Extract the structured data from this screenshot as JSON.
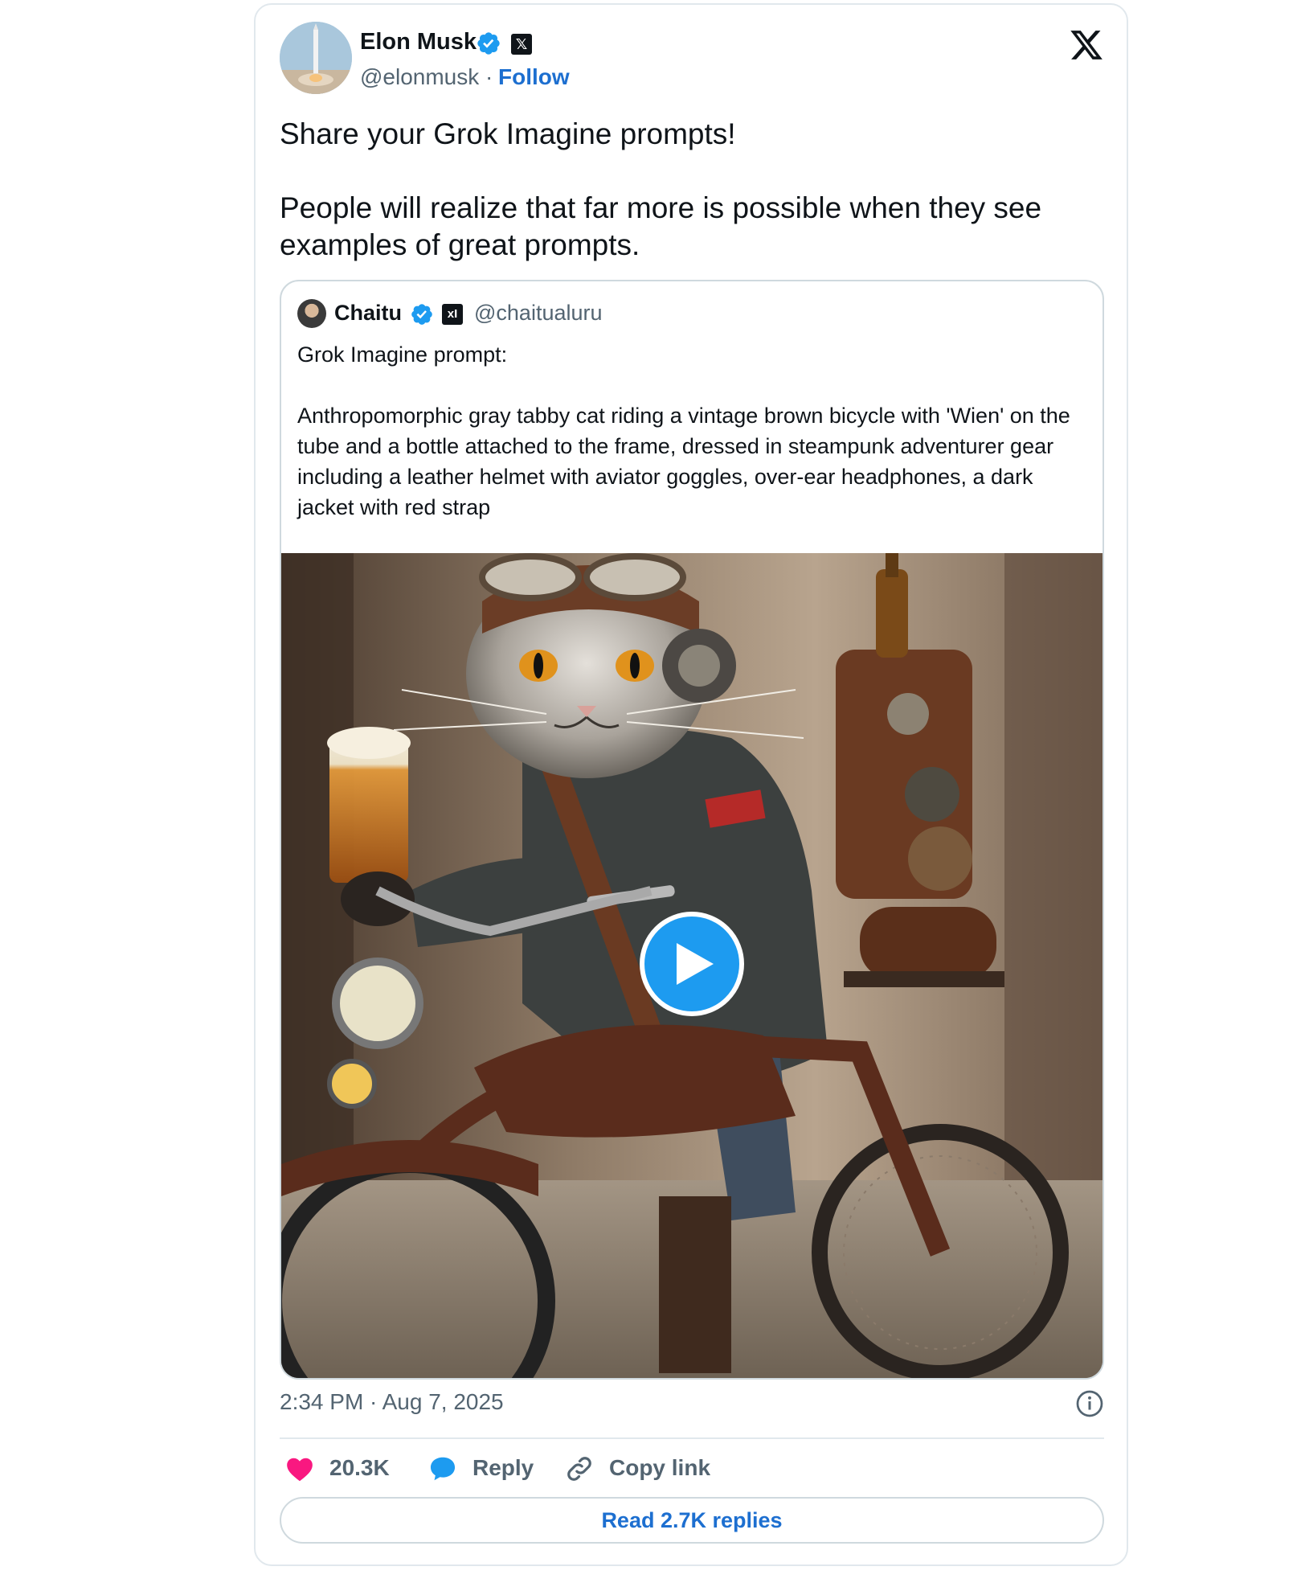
{
  "author": {
    "name": "Elon Musk",
    "handle": "@elonmusk",
    "separator": "·",
    "follow_label": "Follow",
    "affiliation_badge": "𝕏"
  },
  "brand": {
    "logo_icon": "x-logo-icon"
  },
  "tweet": {
    "line1": "Share your Grok Imagine prompts!",
    "line2": "People will realize that far more is possible when they see examples of great prompts."
  },
  "quote": {
    "name": "Chaitu",
    "handle": "@chaitualuru",
    "affiliation_badge": "xI",
    "text_line1": "Grok Imagine prompt:",
    "text_line2": "Anthropomorphic gray tabby cat riding a vintage brown bicycle with 'Wien' on the tube and a bottle attached to the frame, dressed in steampunk adventurer gear including a leather helmet with aviator goggles, over-ear headphones, a dark jacket with red strap",
    "media_type": "video"
  },
  "meta": {
    "timestamp": "2:34 PM · Aug 7, 2025"
  },
  "actions": {
    "like_count": "20.3K",
    "reply_label": "Reply",
    "copy_label": "Copy link",
    "read_replies_label": "Read 2.7K replies"
  },
  "colors": {
    "accent": "#1d6fd0",
    "verified": "#1d9bf0",
    "like": "#f91880",
    "text_primary": "#0f1419",
    "text_secondary": "#536471",
    "border": "#cfd9de"
  }
}
